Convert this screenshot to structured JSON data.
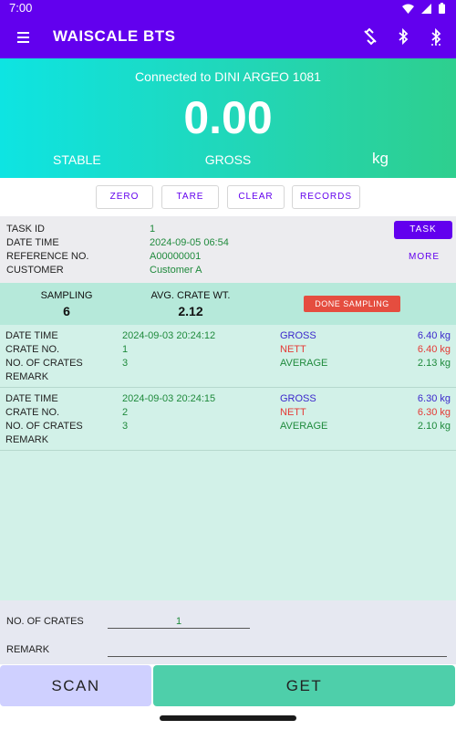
{
  "statusbar": {
    "time": "7:00"
  },
  "appbar": {
    "title": "WAISCALE BTS"
  },
  "weigh": {
    "connection": "Connected to DINI ARGEO 1081",
    "weight": "0.00",
    "stable": "STABLE",
    "mode": "GROSS",
    "unit": "kg"
  },
  "buttons": {
    "zero": "ZERO",
    "tare": "TARE",
    "clear": "CLEAR",
    "records": "RECORDS"
  },
  "task": {
    "labels": {
      "id": "TASK ID",
      "datetime": "DATE TIME",
      "ref": "REFERENCE NO.",
      "customer": "CUSTOMER"
    },
    "values": {
      "id": "1",
      "datetime": "2024-09-05 06:54",
      "ref": "A00000001",
      "customer": "Customer A"
    },
    "task_btn": "TASK",
    "more_btn": "MORE"
  },
  "sampling": {
    "sampling_label": "SAMPLING",
    "sampling_value": "6",
    "avg_label": "AVG. CRATE WT.",
    "avg_value": "2.12",
    "done_btn": "DONE SAMPLING"
  },
  "record_labels": {
    "datetime": "DATE TIME",
    "crate": "CRATE NO.",
    "crates": "NO. OF CRATES",
    "remark": "REMARK",
    "gross": "GROSS",
    "nett": "NETT",
    "average": "AVERAGE"
  },
  "records": [
    {
      "datetime": "2024-09-03 20:24:12",
      "crate": "1",
      "crates": "3",
      "gross": "6.40 kg",
      "nett": "6.40 kg",
      "average": "2.13 kg"
    },
    {
      "datetime": "2024-09-03 20:24:15",
      "crate": "2",
      "crates": "3",
      "gross": "6.30 kg",
      "nett": "6.30 kg",
      "average": "2.10 kg"
    }
  ],
  "inputs": {
    "crates_label": "NO. OF CRATES",
    "crates_value": "1",
    "remark_label": "REMARK",
    "remark_value": ""
  },
  "actions": {
    "scan": "SCAN",
    "get": "GET"
  },
  "colors": {
    "primary": "#6200ee",
    "green_text": "#1f8a3c",
    "gross_text": "#3b28cc",
    "nett_text": "#e53935",
    "done": "#e54d3f",
    "get": "#4ecfaa",
    "scan": "#cfd0ff"
  },
  "icons": [
    "menu-icon",
    "link-off-icon",
    "bluetooth-icon",
    "bluetooth-search-icon",
    "wifi-icon",
    "signal-icon",
    "battery-icon"
  ]
}
